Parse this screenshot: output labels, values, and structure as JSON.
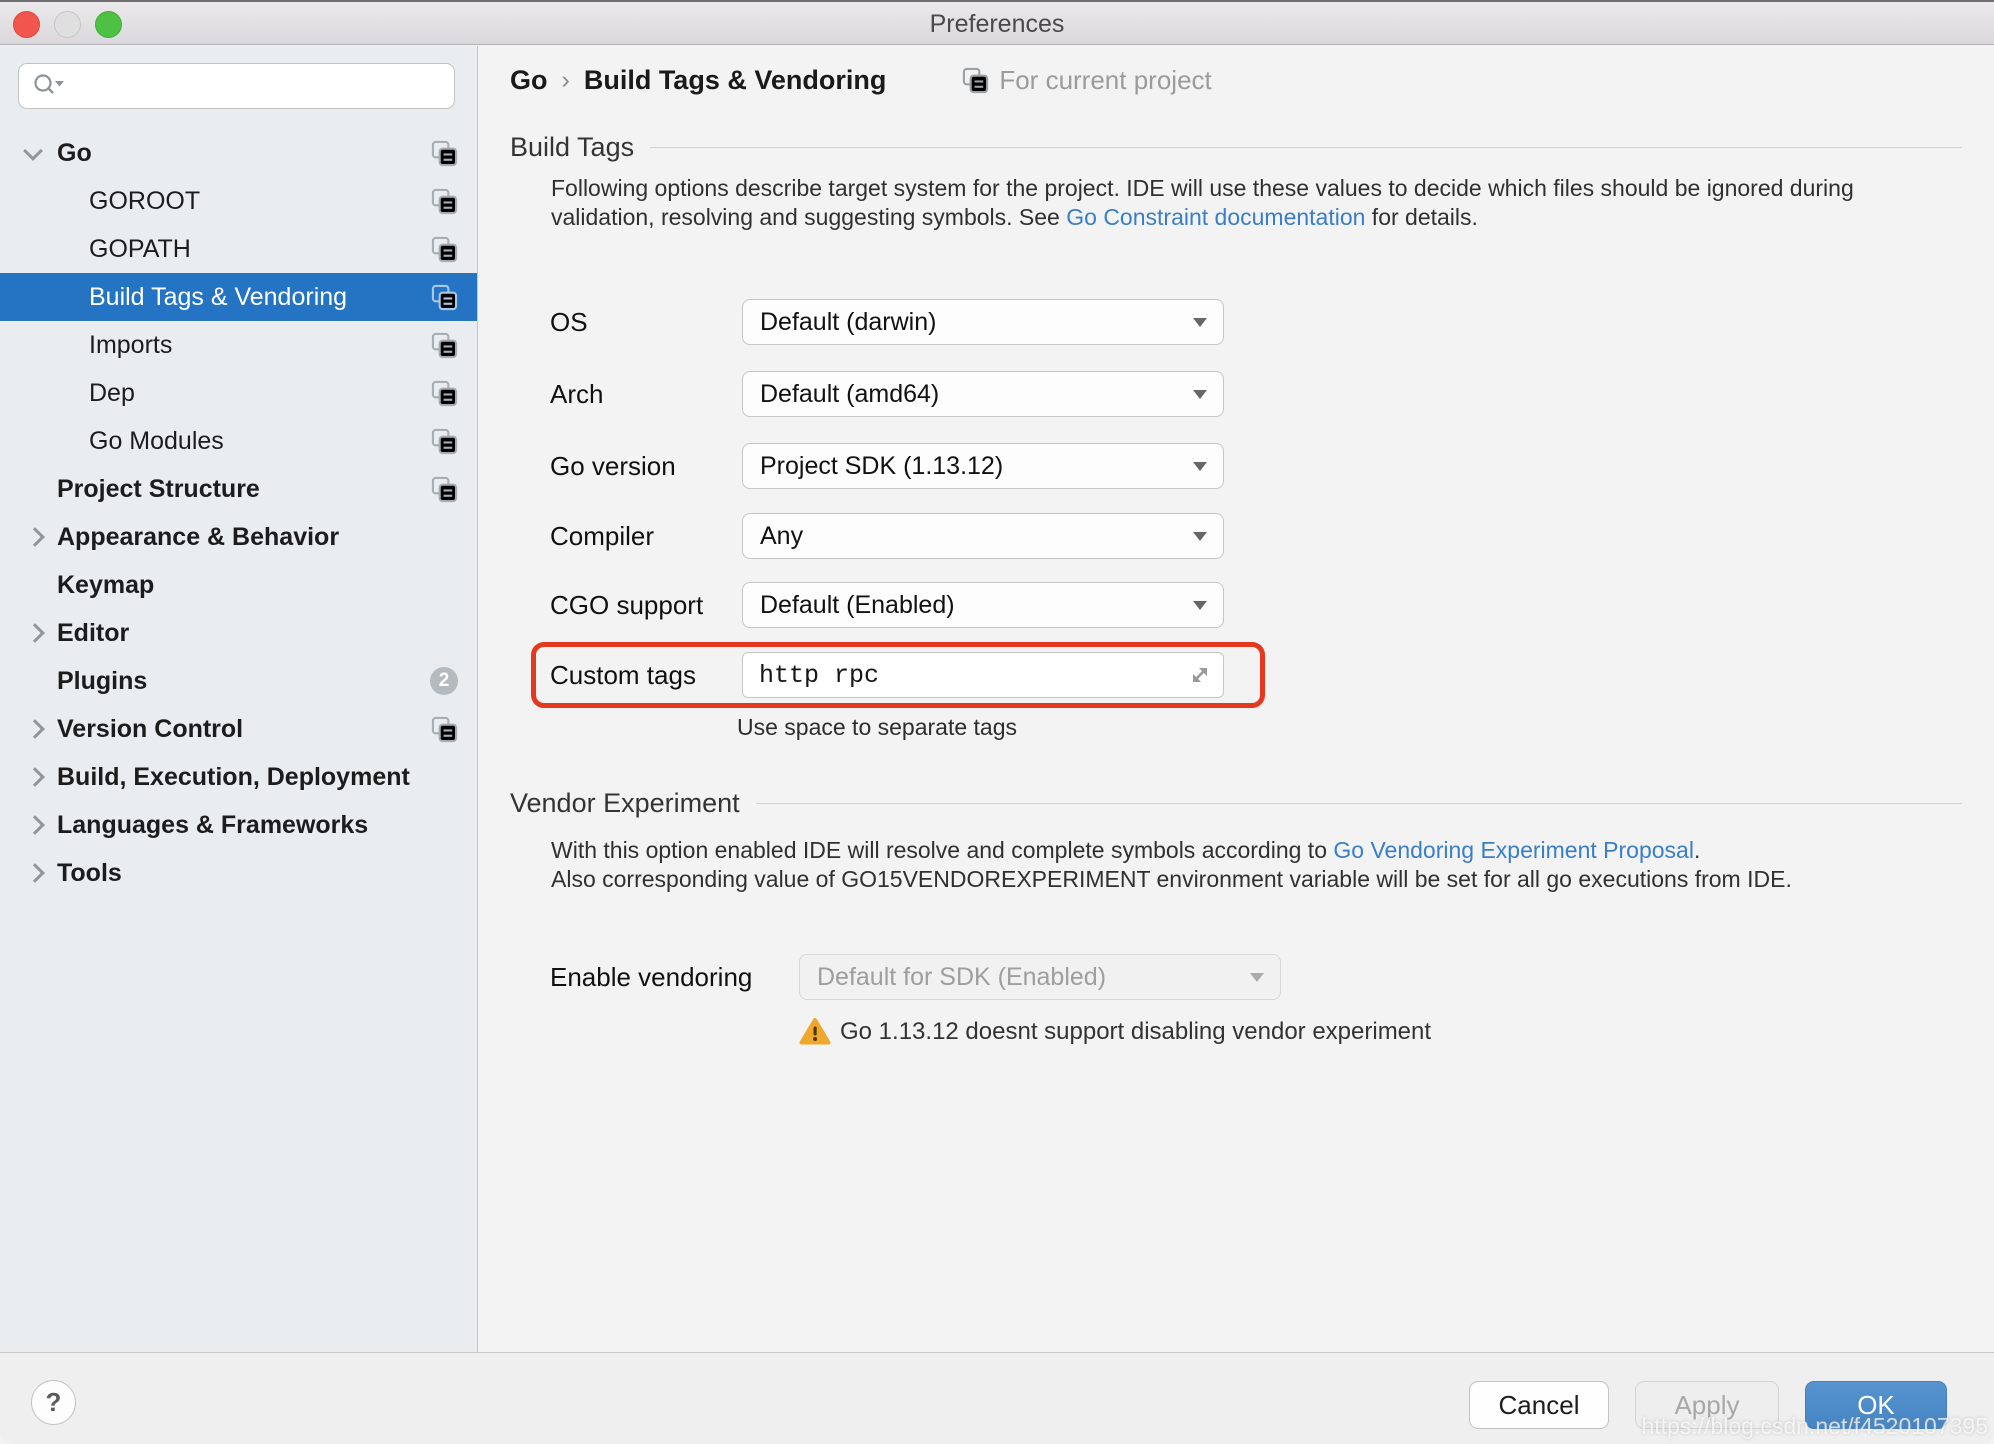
{
  "window": {
    "title": "Preferences"
  },
  "colors": {
    "selection_blue": "#2574c4",
    "link_blue": "#3a7ec7",
    "annotation_red": "#e4391f",
    "ok_button_blue": "#4d8bc8",
    "warning_yellow": "#efa72e"
  },
  "sidebar": {
    "search": {
      "placeholder": ""
    },
    "tree": [
      {
        "label": "Go"
      },
      {
        "label": "GOROOT"
      },
      {
        "label": "GOPATH"
      },
      {
        "label": "Build Tags & Vendoring"
      },
      {
        "label": "Imports"
      },
      {
        "label": "Dep"
      },
      {
        "label": "Go Modules"
      },
      {
        "label": "Project Structure"
      },
      {
        "label": "Appearance & Behavior"
      },
      {
        "label": "Keymap"
      },
      {
        "label": "Editor"
      },
      {
        "label": "Plugins",
        "badge": "2"
      },
      {
        "label": "Version Control"
      },
      {
        "label": "Build, Execution, Deployment"
      },
      {
        "label": "Languages & Frameworks"
      },
      {
        "label": "Tools"
      }
    ]
  },
  "header": {
    "breadcrumb_root": "Go",
    "separator": "›",
    "breadcrumb_page": "Build Tags & Vendoring",
    "scope_label": "For current project"
  },
  "build_tags": {
    "section_title": "Build Tags",
    "desc_line1": "Following options describe target system for the project. IDE will use these values to decide which files should be ignored during",
    "desc_line2_pre": "validation, resolving and suggesting symbols. See ",
    "desc_link": "Go Constraint documentation",
    "desc_line2_post": " for details.",
    "fields": {
      "os": {
        "label": "OS",
        "value": "Default (darwin)"
      },
      "arch": {
        "label": "Arch",
        "value": "Default (amd64)"
      },
      "go_version": {
        "label": "Go version",
        "value": "Project SDK (1.13.12)"
      },
      "compiler": {
        "label": "Compiler",
        "value": "Any"
      },
      "cgo": {
        "label": "CGO support",
        "value": "Default (Enabled)"
      }
    },
    "custom_tags": {
      "label": "Custom tags",
      "value": "http rpc"
    },
    "hint": "Use space to separate tags"
  },
  "vendor": {
    "section_title": "Vendor Experiment",
    "desc_line1_pre": "With this option enabled IDE will resolve and complete symbols according to ",
    "desc_link": "Go Vendoring Experiment Proposal",
    "desc_line1_post": ".",
    "desc_line2": "Also corresponding value of GO15VENDOREXPERIMENT environment variable will be set for all go executions from IDE.",
    "enable": {
      "label": "Enable vendoring",
      "value": "Default for SDK (Enabled)"
    },
    "warning": "Go 1.13.12 doesnt support disabling vendor experiment"
  },
  "footer": {
    "help": "?",
    "cancel": "Cancel",
    "apply": "Apply",
    "ok": "OK"
  },
  "watermark": "https://blog.csdn.net/f4520107395"
}
